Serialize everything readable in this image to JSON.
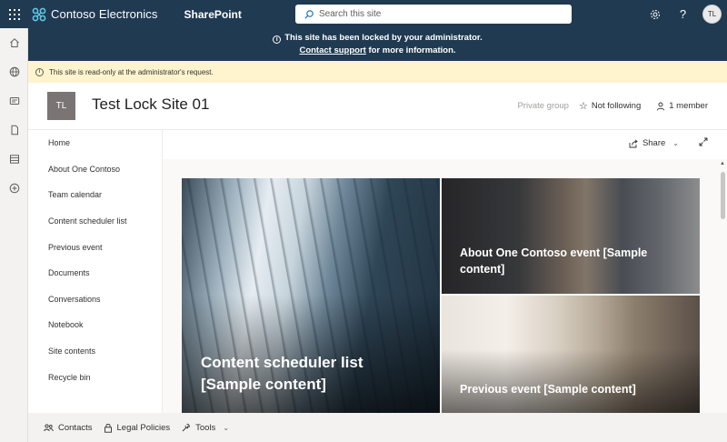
{
  "suitebar": {
    "brand": "Contoso Electronics",
    "app": "SharePoint",
    "search_placeholder": "Search this site",
    "avatar_initials": "TL",
    "icons": [
      "waffle-icon",
      "settings-icon",
      "help-icon"
    ]
  },
  "lock_banner": {
    "message": "This site has been locked by your administrator.",
    "link": "Contact support",
    "suffix": " for more information."
  },
  "readonly_bar": {
    "message": "This site is read-only at the administrator's request."
  },
  "site_header": {
    "logo_initials": "TL",
    "title": "Test Lock Site 01",
    "privacy": "Private group",
    "follow": "Not following",
    "members": "1 member"
  },
  "leftnav": {
    "items": [
      {
        "label": "Home"
      },
      {
        "label": "About One Contoso"
      },
      {
        "label": "Team calendar"
      },
      {
        "label": "Content scheduler list"
      },
      {
        "label": "Previous event"
      },
      {
        "label": "Documents"
      },
      {
        "label": "Conversations"
      },
      {
        "label": "Notebook"
      },
      {
        "label": "Site contents"
      },
      {
        "label": "Recycle bin"
      }
    ]
  },
  "command_bar": {
    "share": "Share"
  },
  "hero": {
    "tiles": [
      {
        "title": "Content scheduler list [Sample content]"
      },
      {
        "title": "About One Contoso event [Sample content]"
      },
      {
        "title": "Previous event [Sample content]"
      }
    ]
  },
  "footer": {
    "items": [
      {
        "label": "Contacts"
      },
      {
        "label": "Legal Policies"
      },
      {
        "label": "Tools"
      }
    ]
  },
  "colors": {
    "suitebar": "#203a52",
    "readonly_bar": "#fff4ce",
    "brand_accent": "#5fc6e6"
  }
}
